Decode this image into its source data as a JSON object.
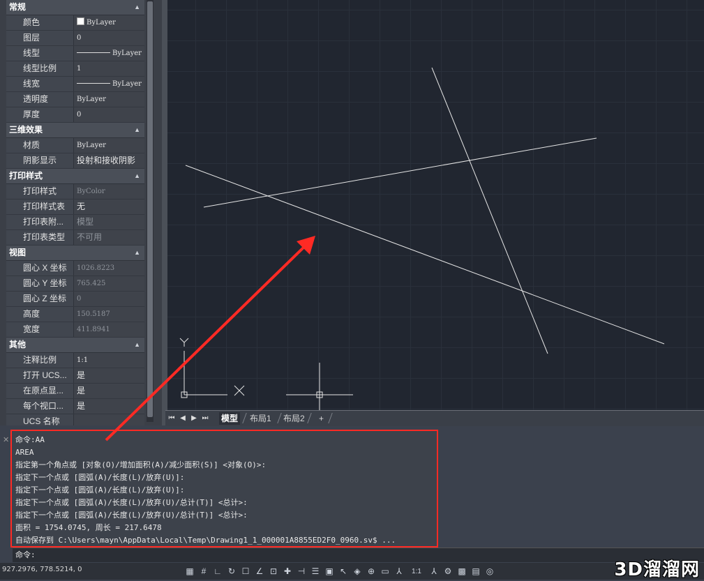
{
  "properties": {
    "sections": [
      {
        "title": "常规",
        "rows": [
          {
            "name": "颜色",
            "value": "ByLayer",
            "kind": "color"
          },
          {
            "name": "图层",
            "value": "0"
          },
          {
            "name": "线型",
            "value": "ByLayer",
            "kind": "linetype"
          },
          {
            "name": "线型比例",
            "value": "1"
          },
          {
            "name": "线宽",
            "value": "ByLayer",
            "kind": "linetype"
          },
          {
            "name": "透明度",
            "value": "ByLayer"
          },
          {
            "name": "厚度",
            "value": "0"
          }
        ]
      },
      {
        "title": "三维效果",
        "rows": [
          {
            "name": "材质",
            "value": "ByLayer"
          },
          {
            "name": "阴影显示",
            "value": "投射和接收阴影",
            "kind": "cjk"
          }
        ]
      },
      {
        "title": "打印样式",
        "rows": [
          {
            "name": "打印样式",
            "value": "ByColor",
            "dim": true
          },
          {
            "name": "打印样式表",
            "value": "无",
            "kind": "cjk"
          },
          {
            "name": "打印表附...",
            "value": "模型",
            "dim": true,
            "kind": "cjk"
          },
          {
            "name": "打印表类型",
            "value": "不可用",
            "dim": true,
            "kind": "cjk"
          }
        ]
      },
      {
        "title": "视图",
        "rows": [
          {
            "name": "圆心 X 坐标",
            "value": "1026.8223",
            "dim": true
          },
          {
            "name": "圆心 Y 坐标",
            "value": "765.425",
            "dim": true
          },
          {
            "name": "圆心 Z 坐标",
            "value": "0",
            "dim": true
          },
          {
            "name": "高度",
            "value": "150.5187",
            "dim": true
          },
          {
            "name": "宽度",
            "value": "411.8941",
            "dim": true
          }
        ]
      },
      {
        "title": "其他",
        "rows": [
          {
            "name": "注释比例",
            "value": "1:1"
          },
          {
            "name": "打开 UCS...",
            "value": "是",
            "kind": "cjk"
          },
          {
            "name": "在原点显...",
            "value": "是",
            "kind": "cjk"
          },
          {
            "name": "每个视口...",
            "value": "是",
            "kind": "cjk"
          },
          {
            "name": "UCS 名称",
            "value": ""
          }
        ]
      }
    ]
  },
  "ucs": {
    "y_label": "Y",
    "x_label": "X"
  },
  "tabs": {
    "model": "模型",
    "layout1": "布局1",
    "layout2": "布局2",
    "add": "+"
  },
  "command_history": [
    "命令:AA",
    "AREA",
    "指定第一个角点或 [对象(O)/增加面积(A)/减少面积(S)] <对象(O)>:",
    "指定下一个点或 [圆弧(A)/长度(L)/放弃(U)]:",
    "指定下一个点或 [圆弧(A)/长度(L)/放弃(U)]:",
    "指定下一个点或 [圆弧(A)/长度(L)/放弃(U)/总计(T)] <总计>:",
    "指定下一个点或 [圆弧(A)/长度(L)/放弃(U)/总计(T)] <总计>:",
    "面积 = 1754.0745, 周长 = 217.6478",
    "自动保存到 C:\\Users\\mayn\\AppData\\Local\\Temp\\Drawing1_1_000001A8855ED2F0_0960.sv$ ..."
  ],
  "command_prompt": "命令:",
  "statusbar": {
    "coords": "927.2976, 778.5214, 0",
    "scale": "1:1"
  },
  "watermark": "3D溜溜网",
  "colors": {
    "canvas": "#212630",
    "highlight": "#ff2a24"
  }
}
